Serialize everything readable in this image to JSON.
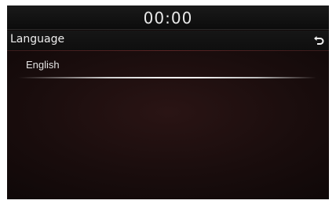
{
  "status_bar": {
    "time": "00:00"
  },
  "header": {
    "title": "Language",
    "back_icon": "back-arrow-icon"
  },
  "language_list": {
    "items": [
      {
        "label": "English"
      }
    ]
  }
}
